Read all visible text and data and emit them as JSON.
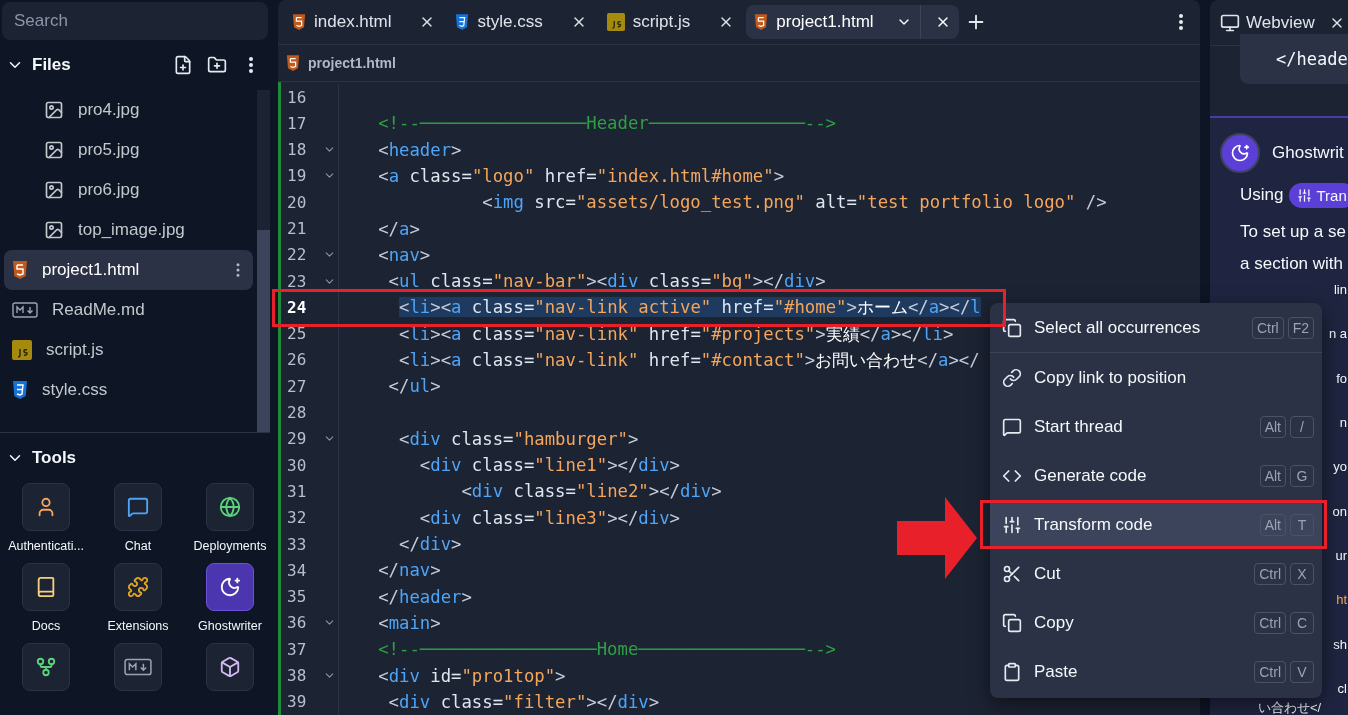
{
  "sidebar": {
    "search": {
      "placeholder": "Search"
    },
    "files_title": "Files",
    "files": [
      {
        "name": "pro4.jpg",
        "kind": "image",
        "selected": false
      },
      {
        "name": "pro5.jpg",
        "kind": "image",
        "selected": false
      },
      {
        "name": "pro6.jpg",
        "kind": "image",
        "selected": false
      },
      {
        "name": "top_image.jpg",
        "kind": "image",
        "selected": false
      },
      {
        "name": "project1.html",
        "kind": "html",
        "selected": true
      },
      {
        "name": "ReadMe.md",
        "kind": "markdown",
        "selected": false
      },
      {
        "name": "script.js",
        "kind": "js",
        "selected": false
      },
      {
        "name": "style.css",
        "kind": "css",
        "selected": false
      }
    ],
    "tools_title": "Tools",
    "tools": [
      {
        "label": "Authenticati...",
        "kind": "user",
        "selected": false
      },
      {
        "label": "Chat",
        "kind": "chat",
        "selected": false
      },
      {
        "label": "Deployments",
        "kind": "globe",
        "selected": false
      },
      {
        "label": "Docs",
        "kind": "book",
        "selected": false
      },
      {
        "label": "Extensions",
        "kind": "puzzle",
        "selected": false
      },
      {
        "label": "Ghostwriter",
        "kind": "ghost",
        "selected": true
      },
      {
        "kind": "branch",
        "selected": false
      },
      {
        "kind": "markdown",
        "selected": false
      },
      {
        "kind": "cube",
        "selected": false
      }
    ]
  },
  "editor": {
    "tabs": [
      {
        "label": "index.html",
        "kind": "html",
        "selected": false
      },
      {
        "label": "style.css",
        "kind": "css",
        "selected": false
      },
      {
        "label": "script.js",
        "kind": "js",
        "selected": false
      },
      {
        "label": "project1.html",
        "kind": "html",
        "selected": true
      }
    ],
    "breadcrumb": {
      "label": "project1.html",
      "kind": "html"
    },
    "lines": [
      {
        "number": "16",
        "foldable": false,
        "selected": false
      },
      {
        "number": "17",
        "foldable": false,
        "selected": false,
        "tokens": [
          {
            "kind": "comment",
            "text": "   <!--────────────────Header───────────────-->"
          }
        ]
      },
      {
        "number": "18",
        "foldable": true,
        "selected": false,
        "tokens": [
          {
            "kind": "punct",
            "text": "   <"
          },
          {
            "kind": "tag",
            "text": "header"
          },
          {
            "kind": "punct",
            "text": ">"
          }
        ]
      },
      {
        "number": "19",
        "foldable": true,
        "selected": false,
        "tokens": [
          {
            "kind": "punct",
            "text": "   <"
          },
          {
            "kind": "tag",
            "text": "a"
          },
          {
            "kind": "attr",
            "text": " class="
          },
          {
            "kind": "string",
            "text": "\"logo\""
          },
          {
            "kind": "attr",
            "text": " href="
          },
          {
            "kind": "string",
            "text": "\"index.html#home\""
          },
          {
            "kind": "punct",
            "text": ">"
          }
        ]
      },
      {
        "number": "20",
        "foldable": false,
        "selected": false,
        "tokens": [
          {
            "kind": "punct",
            "text": "             <"
          },
          {
            "kind": "tag",
            "text": "img"
          },
          {
            "kind": "attr",
            "text": " src="
          },
          {
            "kind": "string",
            "text": "\"assets/logo_test.png\""
          },
          {
            "kind": "attr",
            "text": " alt="
          },
          {
            "kind": "string",
            "text": "\"test portfolio logo\""
          },
          {
            "kind": "punct",
            "text": " />"
          }
        ]
      },
      {
        "number": "21",
        "foldable": false,
        "selected": false,
        "tokens": [
          {
            "kind": "punct",
            "text": "   </"
          },
          {
            "kind": "tag",
            "text": "a"
          },
          {
            "kind": "punct",
            "text": ">"
          }
        ]
      },
      {
        "number": "22",
        "foldable": true,
        "selected": false,
        "tokens": [
          {
            "kind": "punct",
            "text": "   <"
          },
          {
            "kind": "tag",
            "text": "nav"
          },
          {
            "kind": "punct",
            "text": ">"
          }
        ]
      },
      {
        "number": "23",
        "foldable": true,
        "selected": false,
        "tokens": [
          {
            "kind": "punct",
            "text": "    <"
          },
          {
            "kind": "tag",
            "text": "ul"
          },
          {
            "kind": "attr",
            "text": " class="
          },
          {
            "kind": "string",
            "text": "\"nav-bar\""
          },
          {
            "kind": "punct",
            "text": "><"
          },
          {
            "kind": "tag",
            "text": "div"
          },
          {
            "kind": "attr",
            "text": " class="
          },
          {
            "kind": "string",
            "text": "\"bg\""
          },
          {
            "kind": "punct",
            "text": "></"
          },
          {
            "kind": "tag",
            "text": "div"
          },
          {
            "kind": "punct",
            "text": ">"
          }
        ]
      },
      {
        "number": "24",
        "foldable": false,
        "selected": true,
        "tokens": [
          {
            "kind": "punct",
            "text": "     <"
          },
          {
            "kind": "tag",
            "text": "li"
          },
          {
            "kind": "punct",
            "text": "><"
          },
          {
            "kind": "tag",
            "text": "a"
          },
          {
            "kind": "attr",
            "text": " class="
          },
          {
            "kind": "string",
            "text": "\"nav-link active\""
          },
          {
            "kind": "attr",
            "text": " href="
          },
          {
            "kind": "string",
            "text": "\"#home\""
          },
          {
            "kind": "punct",
            "text": ">"
          },
          {
            "kind": "text",
            "text": "ホーム"
          },
          {
            "kind": "punct",
            "text": "</"
          },
          {
            "kind": "tag",
            "text": "a"
          },
          {
            "kind": "punct",
            "text": "></"
          },
          {
            "kind": "tag",
            "text": "l"
          }
        ]
      },
      {
        "number": "25",
        "foldable": false,
        "selected": false,
        "tokens": [
          {
            "kind": "punct",
            "text": "     <"
          },
          {
            "kind": "tag",
            "text": "li"
          },
          {
            "kind": "punct",
            "text": "><"
          },
          {
            "kind": "tag",
            "text": "a"
          },
          {
            "kind": "attr",
            "text": " class="
          },
          {
            "kind": "string",
            "text": "\"nav-link\""
          },
          {
            "kind": "attr",
            "text": " href="
          },
          {
            "kind": "string",
            "text": "\"#projects\""
          },
          {
            "kind": "punct",
            "text": ">"
          },
          {
            "kind": "text",
            "text": "実績"
          },
          {
            "kind": "punct",
            "text": "</"
          },
          {
            "kind": "tag",
            "text": "a"
          },
          {
            "kind": "punct",
            "text": "></"
          },
          {
            "kind": "tag",
            "text": "li"
          },
          {
            "kind": "punct",
            "text": ">"
          }
        ]
      },
      {
        "number": "26",
        "foldable": false,
        "selected": false,
        "tokens": [
          {
            "kind": "punct",
            "text": "     <"
          },
          {
            "kind": "tag",
            "text": "li"
          },
          {
            "kind": "punct",
            "text": "><"
          },
          {
            "kind": "tag",
            "text": "a"
          },
          {
            "kind": "attr",
            "text": " class="
          },
          {
            "kind": "string",
            "text": "\"nav-link\""
          },
          {
            "kind": "attr",
            "text": " href="
          },
          {
            "kind": "string",
            "text": "\"#contact\""
          },
          {
            "kind": "punct",
            "text": ">"
          },
          {
            "kind": "text",
            "text": "お問い合わせ"
          },
          {
            "kind": "punct",
            "text": "</"
          },
          {
            "kind": "tag",
            "text": "a"
          },
          {
            "kind": "punct",
            "text": "></"
          }
        ]
      },
      {
        "number": "27",
        "foldable": false,
        "selected": false,
        "tokens": [
          {
            "kind": "punct",
            "text": "    </"
          },
          {
            "kind": "tag",
            "text": "ul"
          },
          {
            "kind": "punct",
            "text": ">"
          }
        ]
      },
      {
        "number": "28",
        "foldable": false,
        "selected": false
      },
      {
        "number": "29",
        "foldable": true,
        "selected": false,
        "tokens": [
          {
            "kind": "punct",
            "text": "     <"
          },
          {
            "kind": "tag",
            "text": "div"
          },
          {
            "kind": "attr",
            "text": " class="
          },
          {
            "kind": "string",
            "text": "\"hamburger\""
          },
          {
            "kind": "punct",
            "text": ">"
          }
        ]
      },
      {
        "number": "30",
        "foldable": false,
        "selected": false,
        "tokens": [
          {
            "kind": "punct",
            "text": "       <"
          },
          {
            "kind": "tag",
            "text": "div"
          },
          {
            "kind": "attr",
            "text": " class="
          },
          {
            "kind": "string",
            "text": "\"line1\""
          },
          {
            "kind": "punct",
            "text": "></"
          },
          {
            "kind": "tag",
            "text": "div"
          },
          {
            "kind": "punct",
            "text": ">"
          }
        ]
      },
      {
        "number": "31",
        "foldable": false,
        "selected": false,
        "tokens": [
          {
            "kind": "punct",
            "text": "           <"
          },
          {
            "kind": "tag",
            "text": "div"
          },
          {
            "kind": "attr",
            "text": " class="
          },
          {
            "kind": "string",
            "text": "\"line2\""
          },
          {
            "kind": "punct",
            "text": "></"
          },
          {
            "kind": "tag",
            "text": "div"
          },
          {
            "kind": "punct",
            "text": ">"
          }
        ]
      },
      {
        "number": "32",
        "foldable": false,
        "selected": false,
        "tokens": [
          {
            "kind": "punct",
            "text": "       <"
          },
          {
            "kind": "tag",
            "text": "div"
          },
          {
            "kind": "attr",
            "text": " class="
          },
          {
            "kind": "string",
            "text": "\"line3\""
          },
          {
            "kind": "punct",
            "text": "></"
          },
          {
            "kind": "tag",
            "text": "div"
          },
          {
            "kind": "punct",
            "text": ">"
          }
        ]
      },
      {
        "number": "33",
        "foldable": false,
        "selected": false,
        "tokens": [
          {
            "kind": "punct",
            "text": "     </"
          },
          {
            "kind": "tag",
            "text": "div"
          },
          {
            "kind": "punct",
            "text": ">"
          }
        ]
      },
      {
        "number": "34",
        "foldable": false,
        "selected": false,
        "tokens": [
          {
            "kind": "punct",
            "text": "   </"
          },
          {
            "kind": "tag",
            "text": "nav"
          },
          {
            "kind": "punct",
            "text": ">"
          }
        ]
      },
      {
        "number": "35",
        "foldable": false,
        "selected": false,
        "tokens": [
          {
            "kind": "punct",
            "text": "   </"
          },
          {
            "kind": "tag",
            "text": "header"
          },
          {
            "kind": "punct",
            "text": ">"
          }
        ]
      },
      {
        "number": "36",
        "foldable": true,
        "selected": false,
        "tokens": [
          {
            "kind": "punct",
            "text": "   <"
          },
          {
            "kind": "tag",
            "text": "main"
          },
          {
            "kind": "punct",
            "text": ">"
          }
        ]
      },
      {
        "number": "37",
        "foldable": false,
        "selected": false,
        "tokens": [
          {
            "kind": "comment",
            "text": "   <!--─────────────────Home────────────────-->"
          }
        ]
      },
      {
        "number": "38",
        "foldable": true,
        "selected": false,
        "tokens": [
          {
            "kind": "punct",
            "text": "   <"
          },
          {
            "kind": "tag",
            "text": "div"
          },
          {
            "kind": "attr",
            "text": " id="
          },
          {
            "kind": "string",
            "text": "\"pro1top\""
          },
          {
            "kind": "punct",
            "text": ">"
          }
        ]
      },
      {
        "number": "39",
        "foldable": false,
        "selected": false,
        "tokens": [
          {
            "kind": "punct",
            "text": "    <"
          },
          {
            "kind": "tag",
            "text": "div"
          },
          {
            "kind": "attr",
            "text": " class="
          },
          {
            "kind": "string",
            "text": "\"filter\""
          },
          {
            "kind": "punct",
            "text": "></"
          },
          {
            "kind": "tag",
            "text": "div"
          },
          {
            "kind": "punct",
            "text": ">"
          }
        ]
      }
    ]
  },
  "context_menu": [
    {
      "label": "Select all occurrences",
      "kind": "occurrences",
      "keys": [
        "Ctrl",
        "F2"
      ],
      "selected": false,
      "separator_after": true
    },
    {
      "label": "Copy link to position",
      "kind": "link",
      "selected": false,
      "separator_after": false
    },
    {
      "label": "Start thread",
      "kind": "thread",
      "keys": [
        "Alt",
        "/"
      ],
      "selected": false,
      "separator_after": false
    },
    {
      "label": "Generate code",
      "kind": "generate",
      "keys": [
        "Alt",
        "G"
      ],
      "selected": false,
      "separator_after": false
    },
    {
      "label": "Transform code",
      "kind": "transform",
      "keys": [
        "Alt",
        "T"
      ],
      "selected": true,
      "separator_after": false
    },
    {
      "label": "Cut",
      "kind": "cut",
      "keys": [
        "Ctrl",
        "X"
      ],
      "selected": false,
      "separator_after": false
    },
    {
      "label": "Copy",
      "kind": "copy",
      "keys": [
        "Ctrl",
        "C"
      ],
      "selected": false,
      "separator_after": false
    },
    {
      "label": "Paste",
      "kind": "paste",
      "keys": [
        "Ctrl",
        "V"
      ],
      "selected": false,
      "separator_after": false
    }
  ],
  "webview": {
    "tab": "Webview",
    "code_snippet": "</heade",
    "message": {
      "author": "Ghostwrit",
      "using": "Using",
      "chip": "Tran",
      "lines": [
        "To set up a se",
        "a section with"
      ],
      "clipped_lines": [
        {
          "text": "lin",
          "kind": "plain"
        },
        {
          "text": "n a",
          "kind": "plain"
        },
        {
          "text": "fo",
          "kind": "plain"
        },
        {
          "text": "n",
          "kind": "plain"
        },
        {
          "text": "yo",
          "kind": "plain"
        },
        {
          "text": "on",
          "kind": "plain"
        },
        {
          "text": "ur",
          "kind": "plain"
        },
        {
          "text": "ht",
          "kind": "code"
        },
        {
          "text": "sh",
          "kind": "plain"
        },
        {
          "text": "cl",
          "kind": "plain"
        }
      ],
      "last_line": "い合わせ</"
    }
  }
}
